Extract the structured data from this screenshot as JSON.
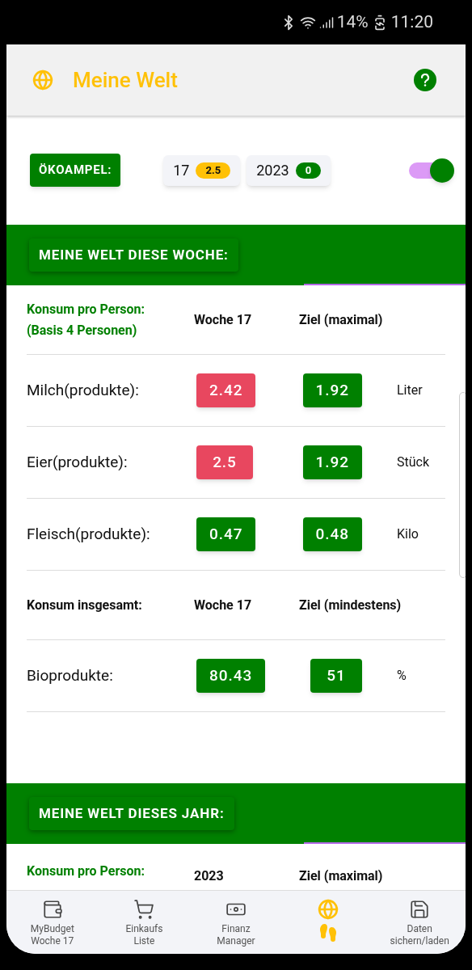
{
  "status_bar": {
    "battery": "14%",
    "time": "11:20"
  },
  "app_bar": {
    "title": "Meine Welt"
  },
  "oekoampel": {
    "label": "ÖKOAMPEL:",
    "chips": [
      {
        "label": "17",
        "badge": "2.5",
        "color": "#ffc107"
      },
      {
        "label": "2023",
        "badge": "0",
        "color": "#008000"
      }
    ],
    "toggle_on": true
  },
  "week_section": {
    "title": "MEINE WELT DIESE WOCHE:",
    "rows": [
      {
        "kind": "header",
        "label": "Konsum pro Person:\n(Basis 4 Personen)",
        "accent": true,
        "col_1": "Woche 17",
        "col_2": "Ziel (maximal)"
      },
      {
        "kind": "value",
        "label": "Milch(produkte):",
        "value": "2.42",
        "over": true,
        "target": "1.92",
        "unit": "Liter"
      },
      {
        "kind": "value",
        "label": "Eier(produkte):",
        "value": "2.5",
        "over": true,
        "target": "1.92",
        "unit": "Stück"
      },
      {
        "kind": "value",
        "label": "Fleisch(produkte):",
        "value": "0.47",
        "over": false,
        "target": "0.48",
        "unit": "Kilo"
      },
      {
        "kind": "header",
        "label": "Konsum insgesamt:",
        "accent": false,
        "col_1": "Woche 17",
        "col_2": "Ziel (mindestens)"
      },
      {
        "kind": "value",
        "label": "Bioprodukte:",
        "value": "80.43",
        "over": false,
        "target": "51",
        "unit": "%"
      }
    ]
  },
  "year_section": {
    "title": "MEINE WELT DIESES JAHR:",
    "header": {
      "label": "Konsum pro Person:",
      "col_1": "2023",
      "col_2": "Ziel (maximal)"
    }
  },
  "bottom_nav": [
    {
      "label": "MyBudget\nWoche 17",
      "selected": false
    },
    {
      "label": "Einkaufs\nListe",
      "selected": false
    },
    {
      "label": "Finanz\nManager",
      "selected": false
    },
    {
      "selected": true
    },
    {
      "label": "Daten\nsichern/laden",
      "selected": false
    }
  ]
}
